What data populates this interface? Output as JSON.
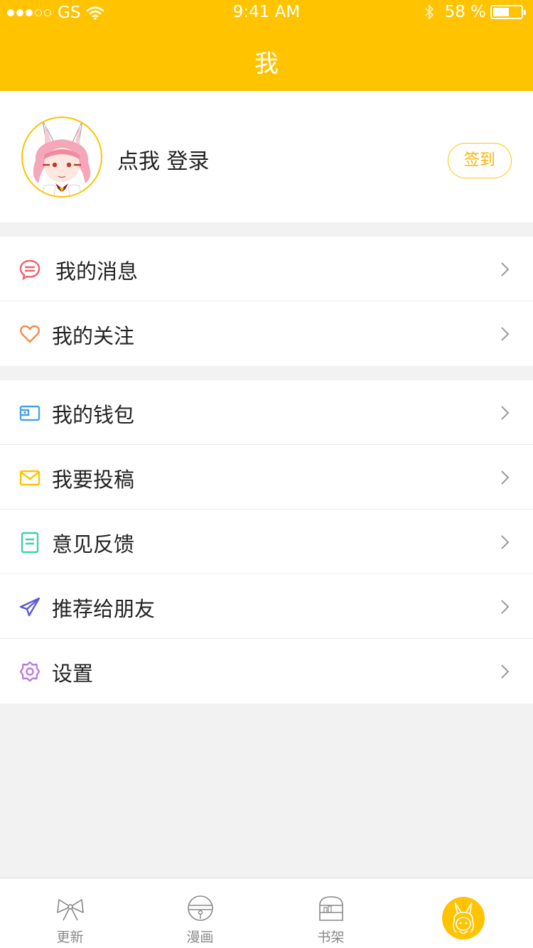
{
  "status_bar": {
    "carrier": "GS",
    "time": "9:41 AM",
    "battery": "58 %",
    "battery_level": 0.58
  },
  "header": {
    "title": "我"
  },
  "profile": {
    "login_text": "点我 登录",
    "checkin_label": "签到"
  },
  "menu_group_1": [
    {
      "label": "我的消息",
      "icon": "message-icon",
      "color": "#f0606a"
    },
    {
      "label": "我的关注",
      "icon": "heart-icon",
      "color": "#f58a4c"
    }
  ],
  "menu_group_2": [
    {
      "label": "我的钱包",
      "icon": "wallet-icon",
      "color": "#4aa3e8"
    },
    {
      "label": "我要投稿",
      "icon": "envelope-icon",
      "color": "#ffc300"
    },
    {
      "label": "意见反馈",
      "icon": "feedback-icon",
      "color": "#3fd1a6"
    },
    {
      "label": "推荐给朋友",
      "icon": "paper-plane-icon",
      "color": "#5b5bd6"
    },
    {
      "label": "设置",
      "icon": "gear-icon",
      "color": "#b97ae6"
    }
  ],
  "tabbar": [
    {
      "label": "更新",
      "icon": "bow-icon"
    },
    {
      "label": "漫画",
      "icon": "bell-icon"
    },
    {
      "label": "书架",
      "icon": "bookshelf-icon"
    },
    {
      "label": "",
      "icon": "bunny-avatar-icon",
      "active": true
    }
  ],
  "colors": {
    "accent": "#ffc300",
    "background": "#f2f2f2"
  }
}
